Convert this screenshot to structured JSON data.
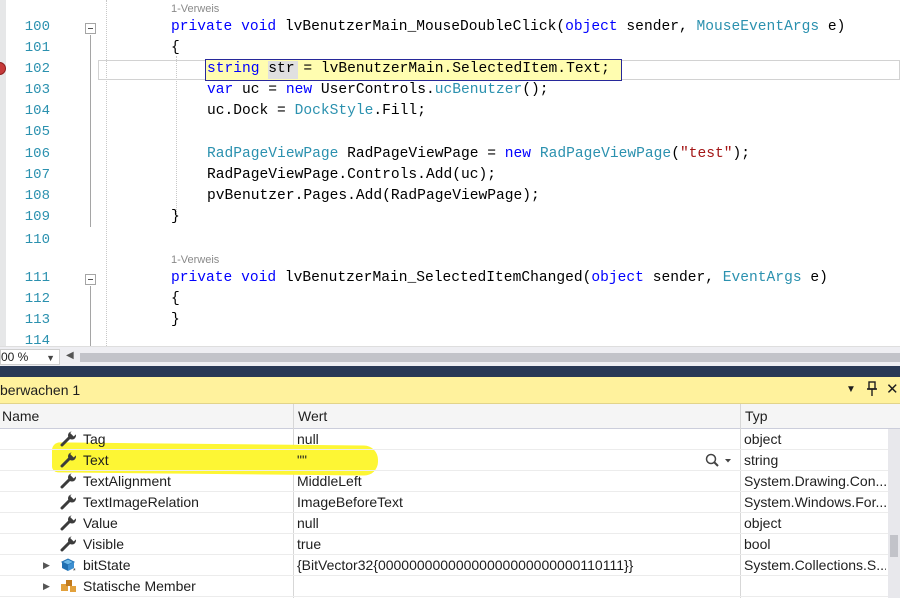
{
  "editor": {
    "line_numbers": [
      "100",
      "101",
      "102",
      "103",
      "104",
      "105",
      "106",
      "107",
      "108",
      "109",
      "110",
      "111",
      "112",
      "113",
      "114"
    ],
    "ref_label_1": "1-Verweis",
    "ref_label_2": "1-Verweis",
    "line_100": [
      "private",
      " ",
      "void",
      " lvBenutzerMain_MouseDoubleClick(",
      "object",
      " sender, ",
      "MouseEventArgs",
      " e)"
    ],
    "line_101": "{",
    "line_102": [
      "string",
      " str = lvBenutzerMain.SelectedItem.Text;"
    ],
    "line_103": [
      "var",
      " uc = ",
      "new",
      " UserControls.",
      "ucBenutzer",
      "();"
    ],
    "line_104": [
      "uc.Dock = ",
      "DockStyle",
      ".Fill;"
    ],
    "line_106": [
      "RadPageViewPage",
      " RadPageViewPage = ",
      "new",
      " ",
      "RadPageViewPage",
      "(",
      "\"test\"",
      ");"
    ],
    "line_107": "RadPageViewPage.Controls.Add(uc);",
    "line_108": "pvBenutzer.Pages.Add(RadPageViewPage);",
    "line_109": "}",
    "line_111": [
      "private",
      " ",
      "void",
      " lvBenutzerMain_SelectedItemChanged(",
      "object",
      " sender, ",
      "EventArgs",
      " e)"
    ],
    "line_112": "{",
    "line_113": "}"
  },
  "statusbar": {
    "zoom": "00 %"
  },
  "watch": {
    "title": "berwachen 1",
    "columns": {
      "name": "Name",
      "value": "Wert",
      "type": "Typ"
    },
    "rows": [
      {
        "name": "Tag",
        "value": "null",
        "type": "object",
        "icon": "wrench-icon"
      },
      {
        "name": "Text",
        "value": "\"\"",
        "type": "string",
        "icon": "wrench-icon"
      },
      {
        "name": "TextAlignment",
        "value": "MiddleLeft",
        "type": "System.Drawing.Con...",
        "icon": "wrench-icon"
      },
      {
        "name": "TextImageRelation",
        "value": "ImageBeforeText",
        "type": "System.Windows.For...",
        "icon": "wrench-icon"
      },
      {
        "name": "Value",
        "value": "null",
        "type": "object",
        "icon": "wrench-icon"
      },
      {
        "name": "Visible",
        "value": "true",
        "type": "bool",
        "icon": "wrench-icon"
      },
      {
        "name": "bitState",
        "value": "{BitVector32{00000000000000000000000000110111}}",
        "type": "System.Collections.S...",
        "icon": "field-icon"
      },
      {
        "name": "Statische Member",
        "value": "",
        "type": "",
        "icon": "static-members-icon"
      }
    ]
  },
  "colors": {
    "keyword": "#0000ff",
    "type": "#2b91af",
    "string": "#a31515",
    "line_number": "#2b91af",
    "watch_header_bg": "#fff29d",
    "highlight_marker": "#fdf634",
    "exec_line_bg": "#fffdb0"
  }
}
